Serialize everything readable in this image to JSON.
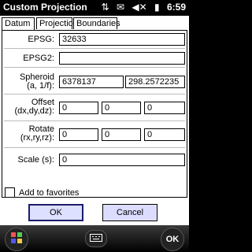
{
  "titlebar": {
    "title": "Custom Projection",
    "time": "6:59",
    "icons": [
      "network-icon",
      "notification-icon",
      "volume-mute-icon",
      "battery-icon"
    ]
  },
  "tabs": [
    {
      "label": "Datum",
      "active": true
    },
    {
      "label": "Projection",
      "active": false
    },
    {
      "label": "Boundaries",
      "active": false
    }
  ],
  "form": {
    "epsg": {
      "label": "EPSG:",
      "value": "32633"
    },
    "epsg2": {
      "label": "EPSG2:",
      "value": ""
    },
    "spheroid": {
      "label_line1": "Spheroid",
      "label_line2": "(a, 1/f):",
      "a": "6378137",
      "f": "298.2572235"
    },
    "offset": {
      "label_line1": "Offset",
      "label_line2": "(dx,dy,dz):",
      "dx": "0",
      "dy": "0",
      "dz": "0"
    },
    "rotate": {
      "label_line1": "Rotate",
      "label_line2": "(rx,ry,rz):",
      "rx": "0",
      "ry": "0",
      "rz": "0"
    },
    "scale": {
      "label": "Scale (s):",
      "value": "0"
    }
  },
  "favorites": {
    "label": "Add to favorites",
    "checked": false
  },
  "buttons": {
    "ok": "OK",
    "cancel": "Cancel"
  },
  "softkeys": {
    "right": "OK"
  }
}
